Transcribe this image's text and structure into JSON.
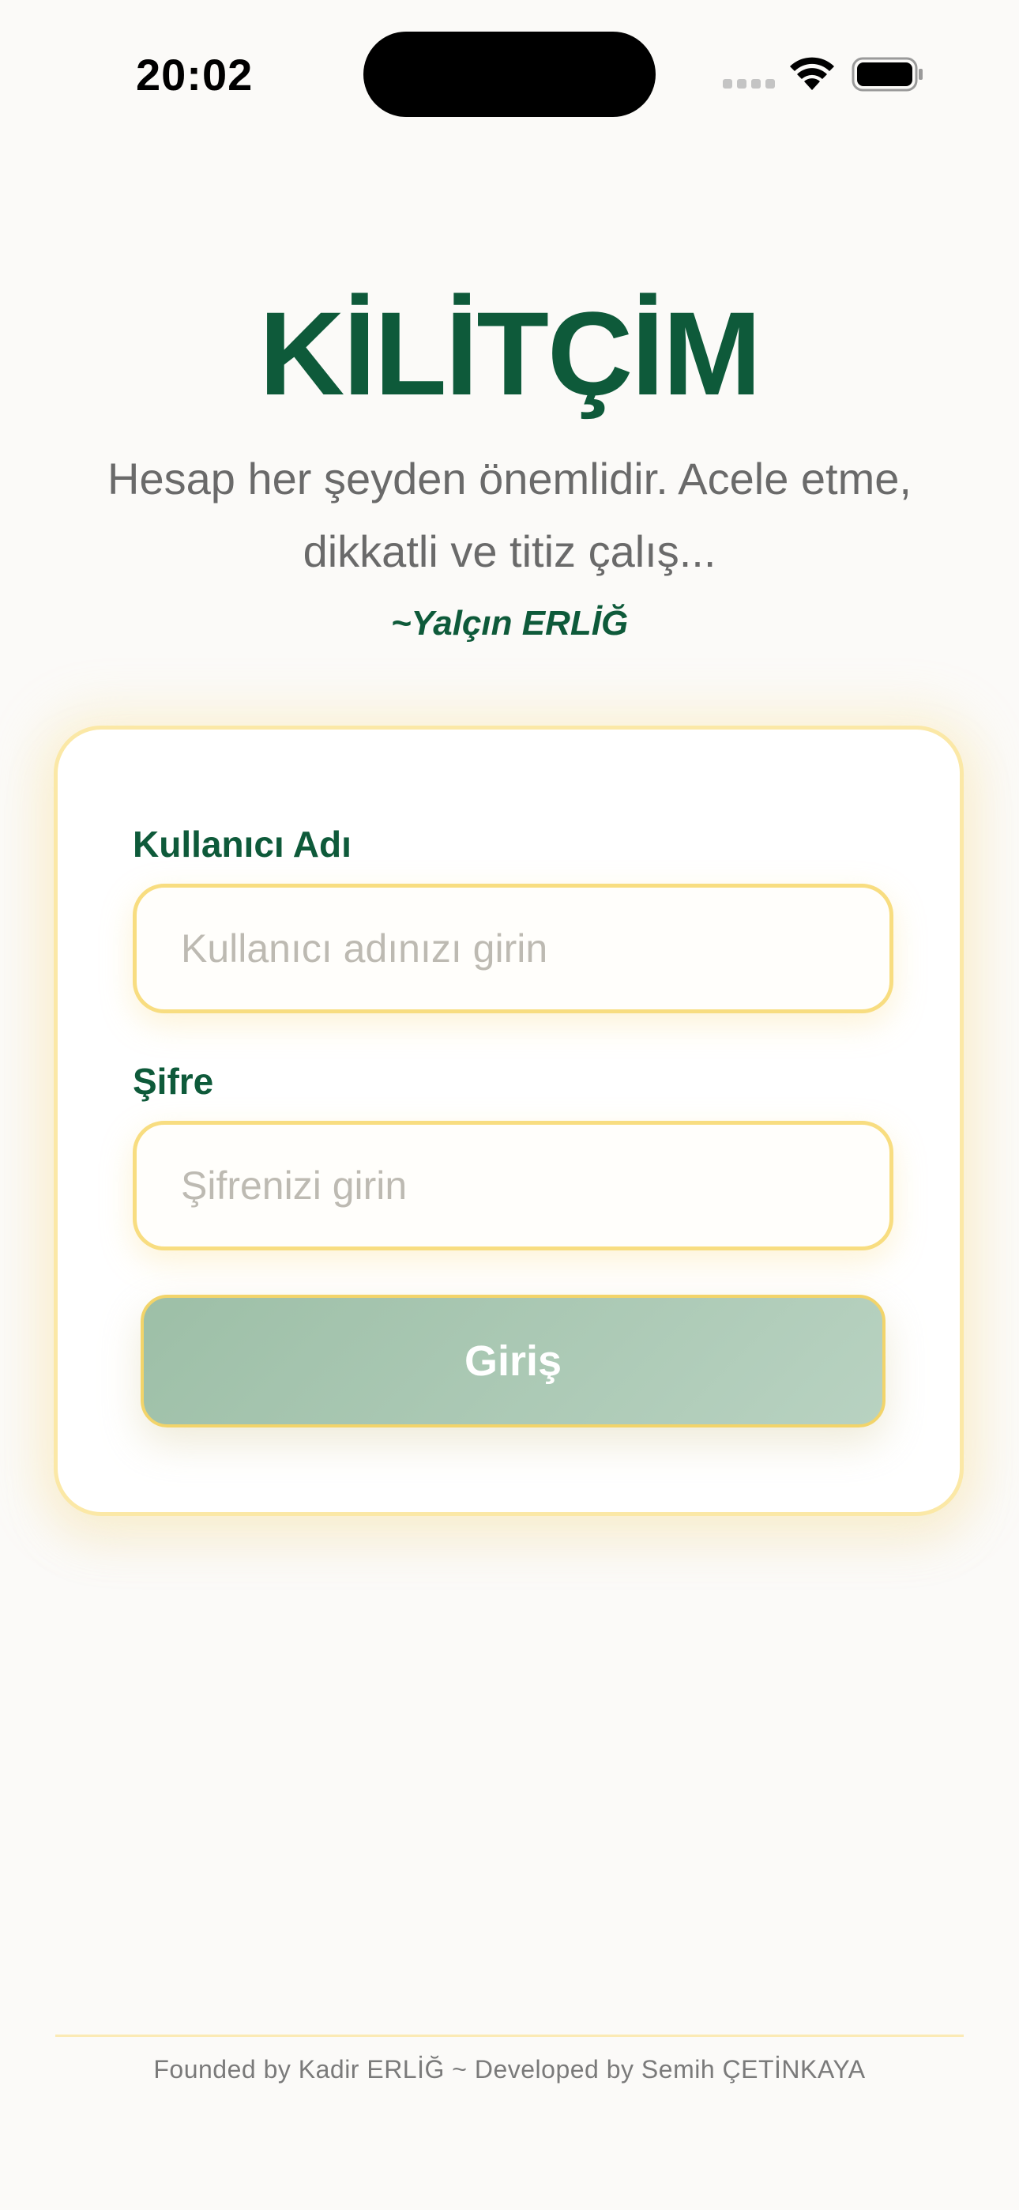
{
  "status_bar": {
    "time": "20:02",
    "icons": [
      "signal-icon",
      "wifi-icon",
      "battery-icon"
    ]
  },
  "header": {
    "title": "KİLİTÇİM",
    "quote": "Hesap her şeyden önemlidir. Acele etme, dikkatli ve titiz çalış...",
    "author": "~Yalçın ERLİĞ"
  },
  "login_form": {
    "username_label": "Kullanıcı Adı",
    "username_placeholder": "Kullanıcı adınızı girin",
    "username_value": "",
    "password_label": "Şifre",
    "password_placeholder": "Şifrenizi girin",
    "password_value": "",
    "submit_label": "Giriş"
  },
  "footer": {
    "credits": "Founded by Kadir ERLİĞ ~ Developed by Semih ÇETİNKAYA"
  },
  "colors": {
    "brand_green": "#0e5a3a",
    "accent_yellow": "#f8dd80",
    "button_green": "#a7c6b0",
    "background": "#fbfaf8"
  }
}
